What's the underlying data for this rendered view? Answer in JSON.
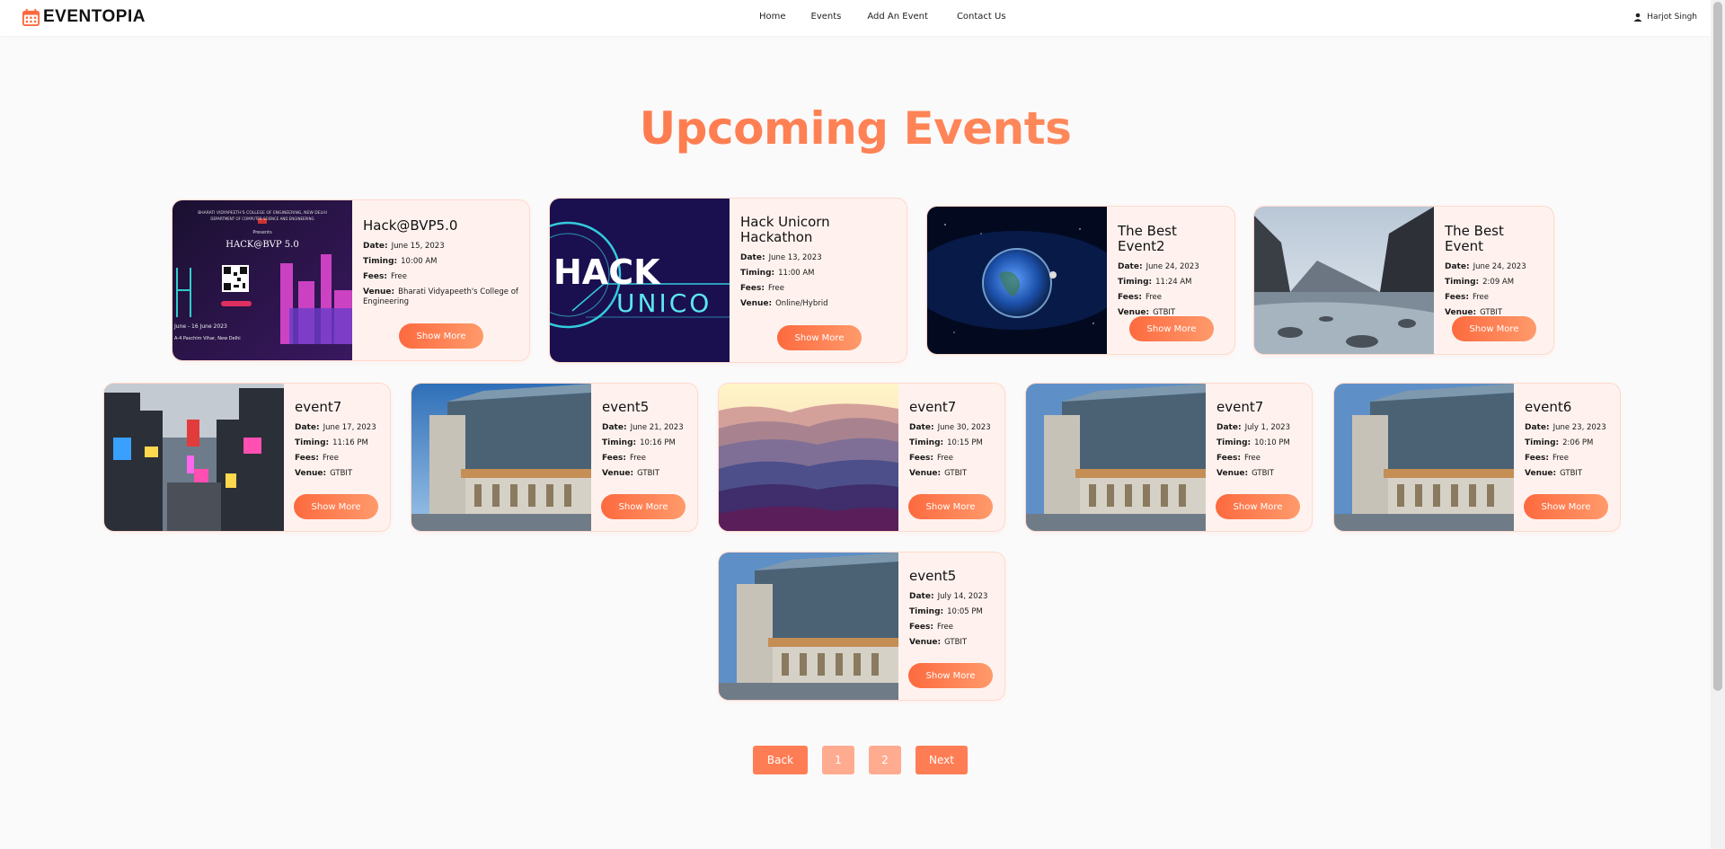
{
  "brand": {
    "name": "EVENTOPIA"
  },
  "nav": {
    "home": "Home",
    "events": "Events",
    "add": "Add An Event",
    "contact": "Contact Us"
  },
  "user": {
    "name": "Harjot Singh"
  },
  "page": {
    "title": "Upcoming Events"
  },
  "labels": {
    "date": "Date:",
    "timing": "Timing:",
    "fees": "Fees:",
    "venue": "Venue:",
    "show_more": "Show More"
  },
  "events": [
    {
      "title": "Hack@BVP5.0",
      "date": "June 15, 2023",
      "timing": "10:00 AM",
      "fees": "Free",
      "venue": "Bharati Vidyapeeth's College of Engineering",
      "image": "hackbvp-poster"
    },
    {
      "title": "Hack Unicorn Hackathon",
      "date": "June 13, 2023",
      "timing": "11:00 AM",
      "fees": "Free",
      "venue": "Online/Hybrid",
      "image": "hack-unicorn-banner"
    },
    {
      "title": "The Best Event2",
      "date": "June 24, 2023",
      "timing": "11:24 AM",
      "fees": "Free",
      "venue": "GTBIT",
      "image": "earth-space"
    },
    {
      "title": "The Best Event",
      "date": "June 24, 2023",
      "timing": "2:09 AM",
      "fees": "Free",
      "venue": "GTBIT",
      "image": "mountain-river"
    },
    {
      "title": "event7",
      "date": "June 17, 2023",
      "timing": "11:16 PM",
      "fees": "Free",
      "venue": "GTBIT",
      "image": "city-street"
    },
    {
      "title": "event5",
      "date": "June 21, 2023",
      "timing": "10:16 PM",
      "fees": "Free",
      "venue": "GTBIT",
      "image": "modern-building"
    },
    {
      "title": "event7",
      "date": "June 30, 2023",
      "timing": "10:15 PM",
      "fees": "Free",
      "venue": "GTBIT",
      "image": "misty-mountains"
    },
    {
      "title": "event7",
      "date": "July 1, 2023",
      "timing": "10:10 PM",
      "fees": "Free",
      "venue": "GTBIT",
      "image": "modern-building"
    },
    {
      "title": "event6",
      "date": "June 23, 2023",
      "timing": "2:06 PM",
      "fees": "Free",
      "venue": "GTBIT",
      "image": "modern-building"
    },
    {
      "title": "event5",
      "date": "July 14, 2023",
      "timing": "10:05 PM",
      "fees": "Free",
      "venue": "GTBIT",
      "image": "modern-building"
    }
  ],
  "pagination": {
    "back": "Back",
    "pages": [
      "1",
      "2"
    ],
    "next": "Next"
  },
  "poster": {
    "line1": "BHARATI VIDYAPEETH'S COLLEGE OF ENGINEERING, NEW DELHI",
    "line2": "DEPARTMENT OF COMPUTER SCIENCE AND ENGINEERING",
    "line3": "Presents",
    "title": "HACK@BVP 5.0",
    "dates": "June - 16 June 2023",
    "place": "A-4 Paschim Vihar, New Delhi"
  },
  "banner": {
    "top": "HACK",
    "bottom": "UNICO"
  },
  "colors": {
    "accent": "#fd6a3f",
    "accent_light": "#ff9a6b",
    "card_bg": "#fff2ee"
  }
}
